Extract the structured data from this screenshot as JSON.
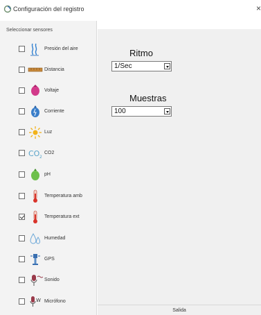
{
  "window": {
    "title": "Configuración del registro",
    "close_glyph": "×"
  },
  "sidebar": {
    "heading": "Seleccionar sensores",
    "sensors": [
      {
        "label": "Presión del aire",
        "icon": "pressure-icon",
        "checked": false
      },
      {
        "label": "Distancia",
        "icon": "distance-icon",
        "checked": false
      },
      {
        "label": "Voltaje",
        "icon": "voltage-icon",
        "checked": false
      },
      {
        "label": "Corriente",
        "icon": "current-icon",
        "checked": false
      },
      {
        "label": "Luz",
        "icon": "light-icon",
        "checked": false
      },
      {
        "label": "CO2",
        "icon": "co2-icon",
        "checked": false
      },
      {
        "label": "pH",
        "icon": "ph-icon",
        "checked": false
      },
      {
        "label": "Temperatura amb",
        "icon": "thermometer-icon",
        "checked": false
      },
      {
        "label": "Temperatura ext",
        "icon": "thermometer-icon",
        "checked": true
      },
      {
        "label": "Humedad",
        "icon": "humidity-icon",
        "checked": false
      },
      {
        "label": "GPS",
        "icon": "gps-icon",
        "checked": false
      },
      {
        "label": "Sonido",
        "icon": "sound-icon",
        "checked": false
      },
      {
        "label": "Micrófono",
        "icon": "microphone-icon",
        "checked": false
      }
    ]
  },
  "main": {
    "rate": {
      "label": "Ritmo",
      "value": "1/Sec"
    },
    "samples": {
      "label": "Muestras",
      "value": "100"
    }
  },
  "footer": {
    "exit_label": "Salida"
  }
}
